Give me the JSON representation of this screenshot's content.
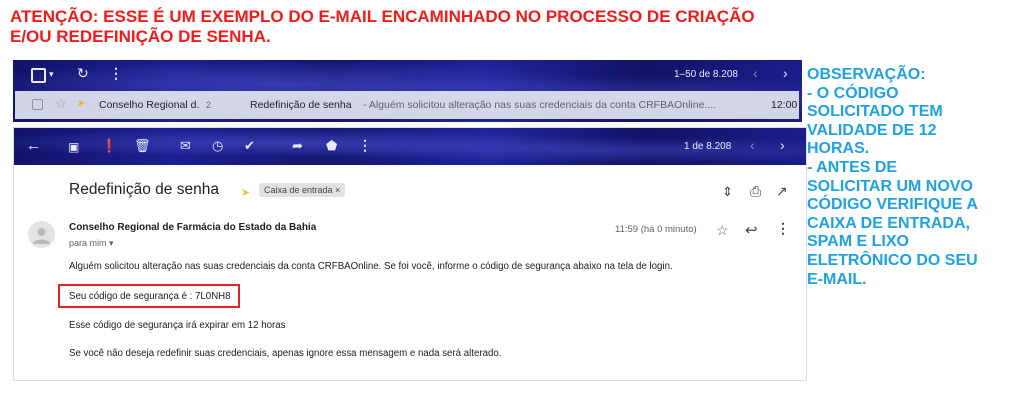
{
  "warning": {
    "line1": "ATENÇÃO: ESSE É UM EXEMPLO DO E-MAIL ENCAMINHADO NO PROCESSO DE CRIAÇÃO",
    "line2": "E/OU REDEFINIÇÃO DE SENHA."
  },
  "note": {
    "lines": [
      "OBSERVAÇÃO:",
      "- O CÓDIGO",
      "SOLICITADO TEM",
      "VALIDADE DE 12",
      "HORAS.",
      "- ANTES DE",
      "SOLICITAR UM NOVO",
      "CÓDIGO VERIFIQUE A",
      "CAIXA DE ENTRADA,",
      "SPAM E LIXO",
      "ELETRÔNICO DO SEU",
      "E-MAIL."
    ]
  },
  "inbox": {
    "pagination": "1–50 de 8.208",
    "row": {
      "sender": "Conselho Regional d.",
      "count": "2",
      "subject": "Redefinição de senha",
      "snippet": "- Alguém solicitou alteração nas suas credenciais da conta CRFBAOnline....",
      "time": "12:00"
    }
  },
  "message": {
    "pagination": "1 de 8.208",
    "subject": "Redefinição de senha",
    "label": "Caixa de entrada",
    "sender": "Conselho Regional de Farmácia do Estado da Bahia",
    "to": "para mim",
    "time": "11:59 (há 0 minuto)",
    "body": {
      "line1": "Alguém solicitou alteração nas suas credenciais da conta CRFBAOnline. Se foi você, informe o código de segurança abaixo na tela de login.",
      "code_line": "Seu código de segurança é : 7L0NH8",
      "line3": "Esse código de segurança irá expirar em 12 horas",
      "line4": "Se você não deseja redefinir suas credenciais, apenas ignore essa mensagem e nada será alterado."
    }
  },
  "colors": {
    "warning": "#f21b1b",
    "note": "#1fa3e0",
    "highlight_border": "#e4222a"
  }
}
